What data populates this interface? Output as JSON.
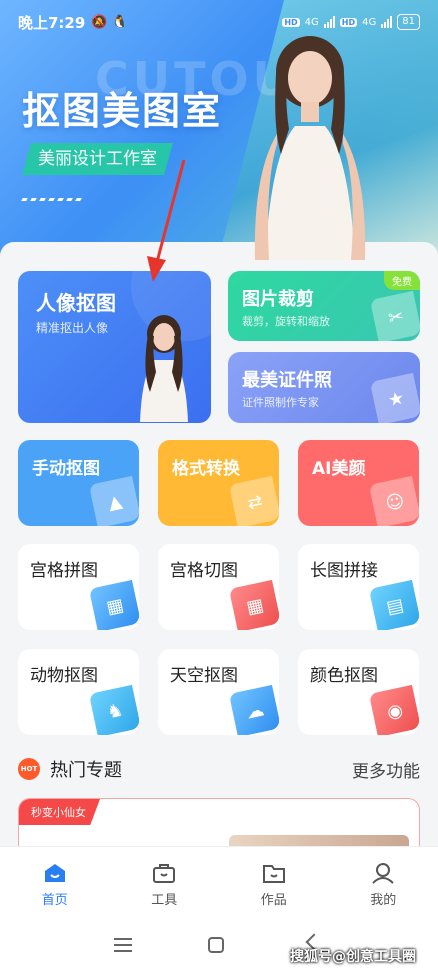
{
  "status_bar": {
    "time": "晚上7:29",
    "battery": "81",
    "net1": "4G",
    "net2": "4G",
    "hd": "HD"
  },
  "banner": {
    "ghost_text": "CUTOUT",
    "title": "抠图美图室",
    "subtitle": "美丽设计工作室"
  },
  "featured": [
    {
      "title": "人像抠图",
      "subtitle": "精准抠出人像"
    },
    {
      "title": "图片裁剪",
      "subtitle": "裁剪，旋转和缩放",
      "badge": "免费"
    },
    {
      "title": "最美证件照",
      "subtitle": "证件照制作专家"
    }
  ],
  "tools_color": [
    {
      "title": "手动抠图",
      "icon": "image-icon",
      "color": "#4ba3f7"
    },
    {
      "title": "格式转换",
      "icon": "image-convert-icon",
      "color": "#ffb934"
    },
    {
      "title": "AI美颜",
      "icon": "face-icon",
      "color": "#ff6b6b"
    }
  ],
  "tools_white": [
    {
      "title": "宫格拼图",
      "icon": "grid-collage-icon"
    },
    {
      "title": "宫格切图",
      "icon": "grid-cut-icon"
    },
    {
      "title": "长图拼接",
      "icon": "long-image-icon"
    },
    {
      "title": "动物抠图",
      "icon": "animal-icon"
    },
    {
      "title": "天空抠图",
      "icon": "sky-icon"
    },
    {
      "title": "颜色抠图",
      "icon": "palette-icon"
    }
  ],
  "hot": {
    "badge": "HOT",
    "title": "热门专题",
    "more": "更多功能",
    "promo_tag": "秒变小仙女"
  },
  "tabs": [
    {
      "label": "首页",
      "icon": "home-icon",
      "active": true
    },
    {
      "label": "工具",
      "icon": "toolbox-icon",
      "active": false
    },
    {
      "label": "作品",
      "icon": "folder-icon",
      "active": false
    },
    {
      "label": "我的",
      "icon": "profile-icon",
      "active": false
    }
  ],
  "watermark": "搜狐号@创意工具圈"
}
